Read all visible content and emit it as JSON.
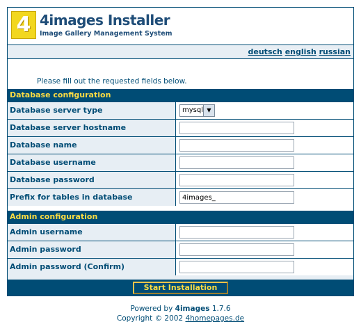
{
  "header": {
    "logo_mark": "4",
    "title": "4images Installer",
    "subtitle": "Image Gallery Management System"
  },
  "languages": [
    "deutsch",
    "english",
    "russian"
  ],
  "intro": "Please fill out the requested fields below.",
  "database": {
    "section_title": "Database configuration",
    "server_type_label": "Database server type",
    "server_type_value": "mysql",
    "hostname_label": "Database server hostname",
    "name_label": "Database name",
    "username_label": "Database username",
    "password_label": "Database password",
    "prefix_label": "Prefix for tables in database",
    "prefix_value": "4images_"
  },
  "admin": {
    "section_title": "Admin configuration",
    "username_label": "Admin username",
    "password_label": "Admin password",
    "password_confirm_label": "Admin password (Confirm)"
  },
  "submit_label": "Start Installation",
  "footer": {
    "powered_prefix": "Powered by",
    "product": "4images",
    "version": "1.7.6",
    "copyright": "Copyright © 2002",
    "link": "4homepages.de"
  },
  "colors": {
    "primary": "#004c75",
    "row_bg": "#e7eef4",
    "accent_yellow": "#fcdc43",
    "logo_yellow": "#f2d71f"
  }
}
